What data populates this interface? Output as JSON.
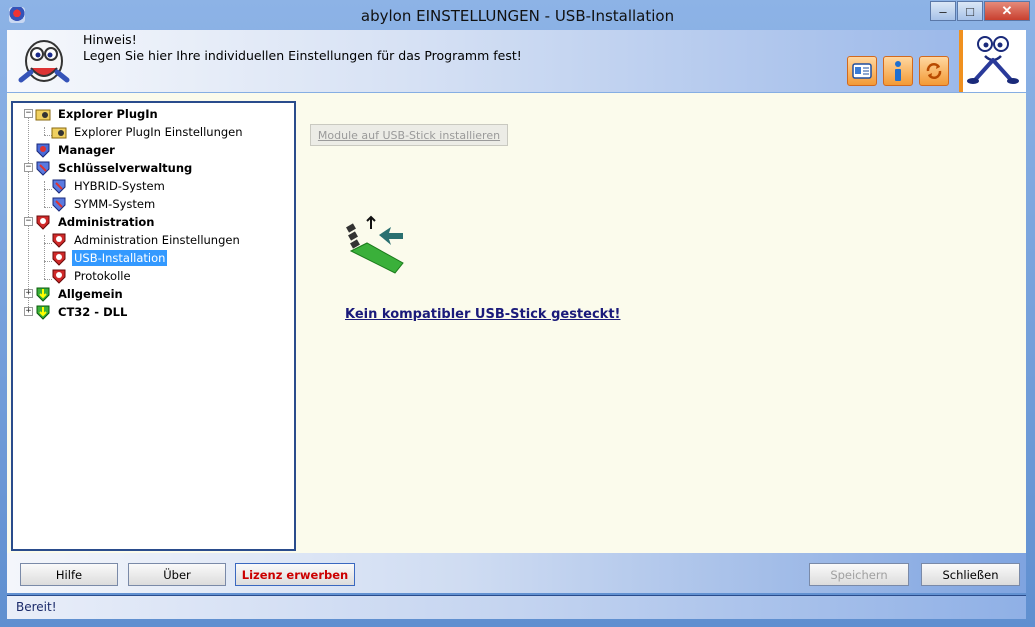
{
  "window": {
    "title": "abylon EINSTELLUNGEN - USB-Installation",
    "controls": {
      "minimize": "–",
      "maximize": "□",
      "close": "✕"
    }
  },
  "header": {
    "hint_title": "Hinweis!",
    "hint_text": "Legen Sie hier Ihre individuellen Einstellungen für das Programm fest!",
    "buttons": [
      "card-icon",
      "info-icon",
      "refresh-icon"
    ]
  },
  "tree": {
    "items": [
      {
        "label": "Explorer PlugIn",
        "bold": true,
        "icon": "folder-key-icon",
        "expander": "−"
      },
      {
        "label": "Explorer PlugIn Einstellungen",
        "bold": false,
        "icon": "folder-key-icon"
      },
      {
        "label": "Manager",
        "bold": true,
        "icon": "manager-icon"
      },
      {
        "label": "Schlüsselverwaltung",
        "bold": true,
        "icon": "shield-blue-icon",
        "expander": "−"
      },
      {
        "label": "HYBRID-System",
        "bold": false,
        "icon": "shield-blue-icon"
      },
      {
        "label": "SYMM-System",
        "bold": false,
        "icon": "shield-blue-icon"
      },
      {
        "label": "Administration",
        "bold": true,
        "icon": "shield-red-icon",
        "expander": "−"
      },
      {
        "label": "Administration Einstellungen",
        "bold": false,
        "icon": "shield-red-icon"
      },
      {
        "label": "USB-Installation",
        "bold": false,
        "icon": "shield-red-icon",
        "selected": true
      },
      {
        "label": "Protokolle",
        "bold": false,
        "icon": "shield-red-icon"
      },
      {
        "label": "Allgemein",
        "bold": true,
        "icon": "shield-green-icon",
        "expander": "+"
      },
      {
        "label": "CT32 - DLL",
        "bold": true,
        "icon": "shield-green-icon",
        "expander": "+"
      }
    ]
  },
  "main": {
    "install_button": "Module auf USB-Stick installieren",
    "usb_message": "Kein kompatibler USB-Stick gesteckt!",
    "usb_icon": "usb-stick-icon"
  },
  "footer": {
    "hilfe": "Hilfe",
    "ueber": "Über",
    "lizenz": "Lizenz erwerben",
    "speichern": "Speichern",
    "schliessen": "Schließen"
  },
  "status": {
    "text": "Bereit!"
  },
  "colors": {
    "accent_orange": "#f0901e",
    "selection": "#3399ff",
    "link_red": "#cc0000"
  }
}
